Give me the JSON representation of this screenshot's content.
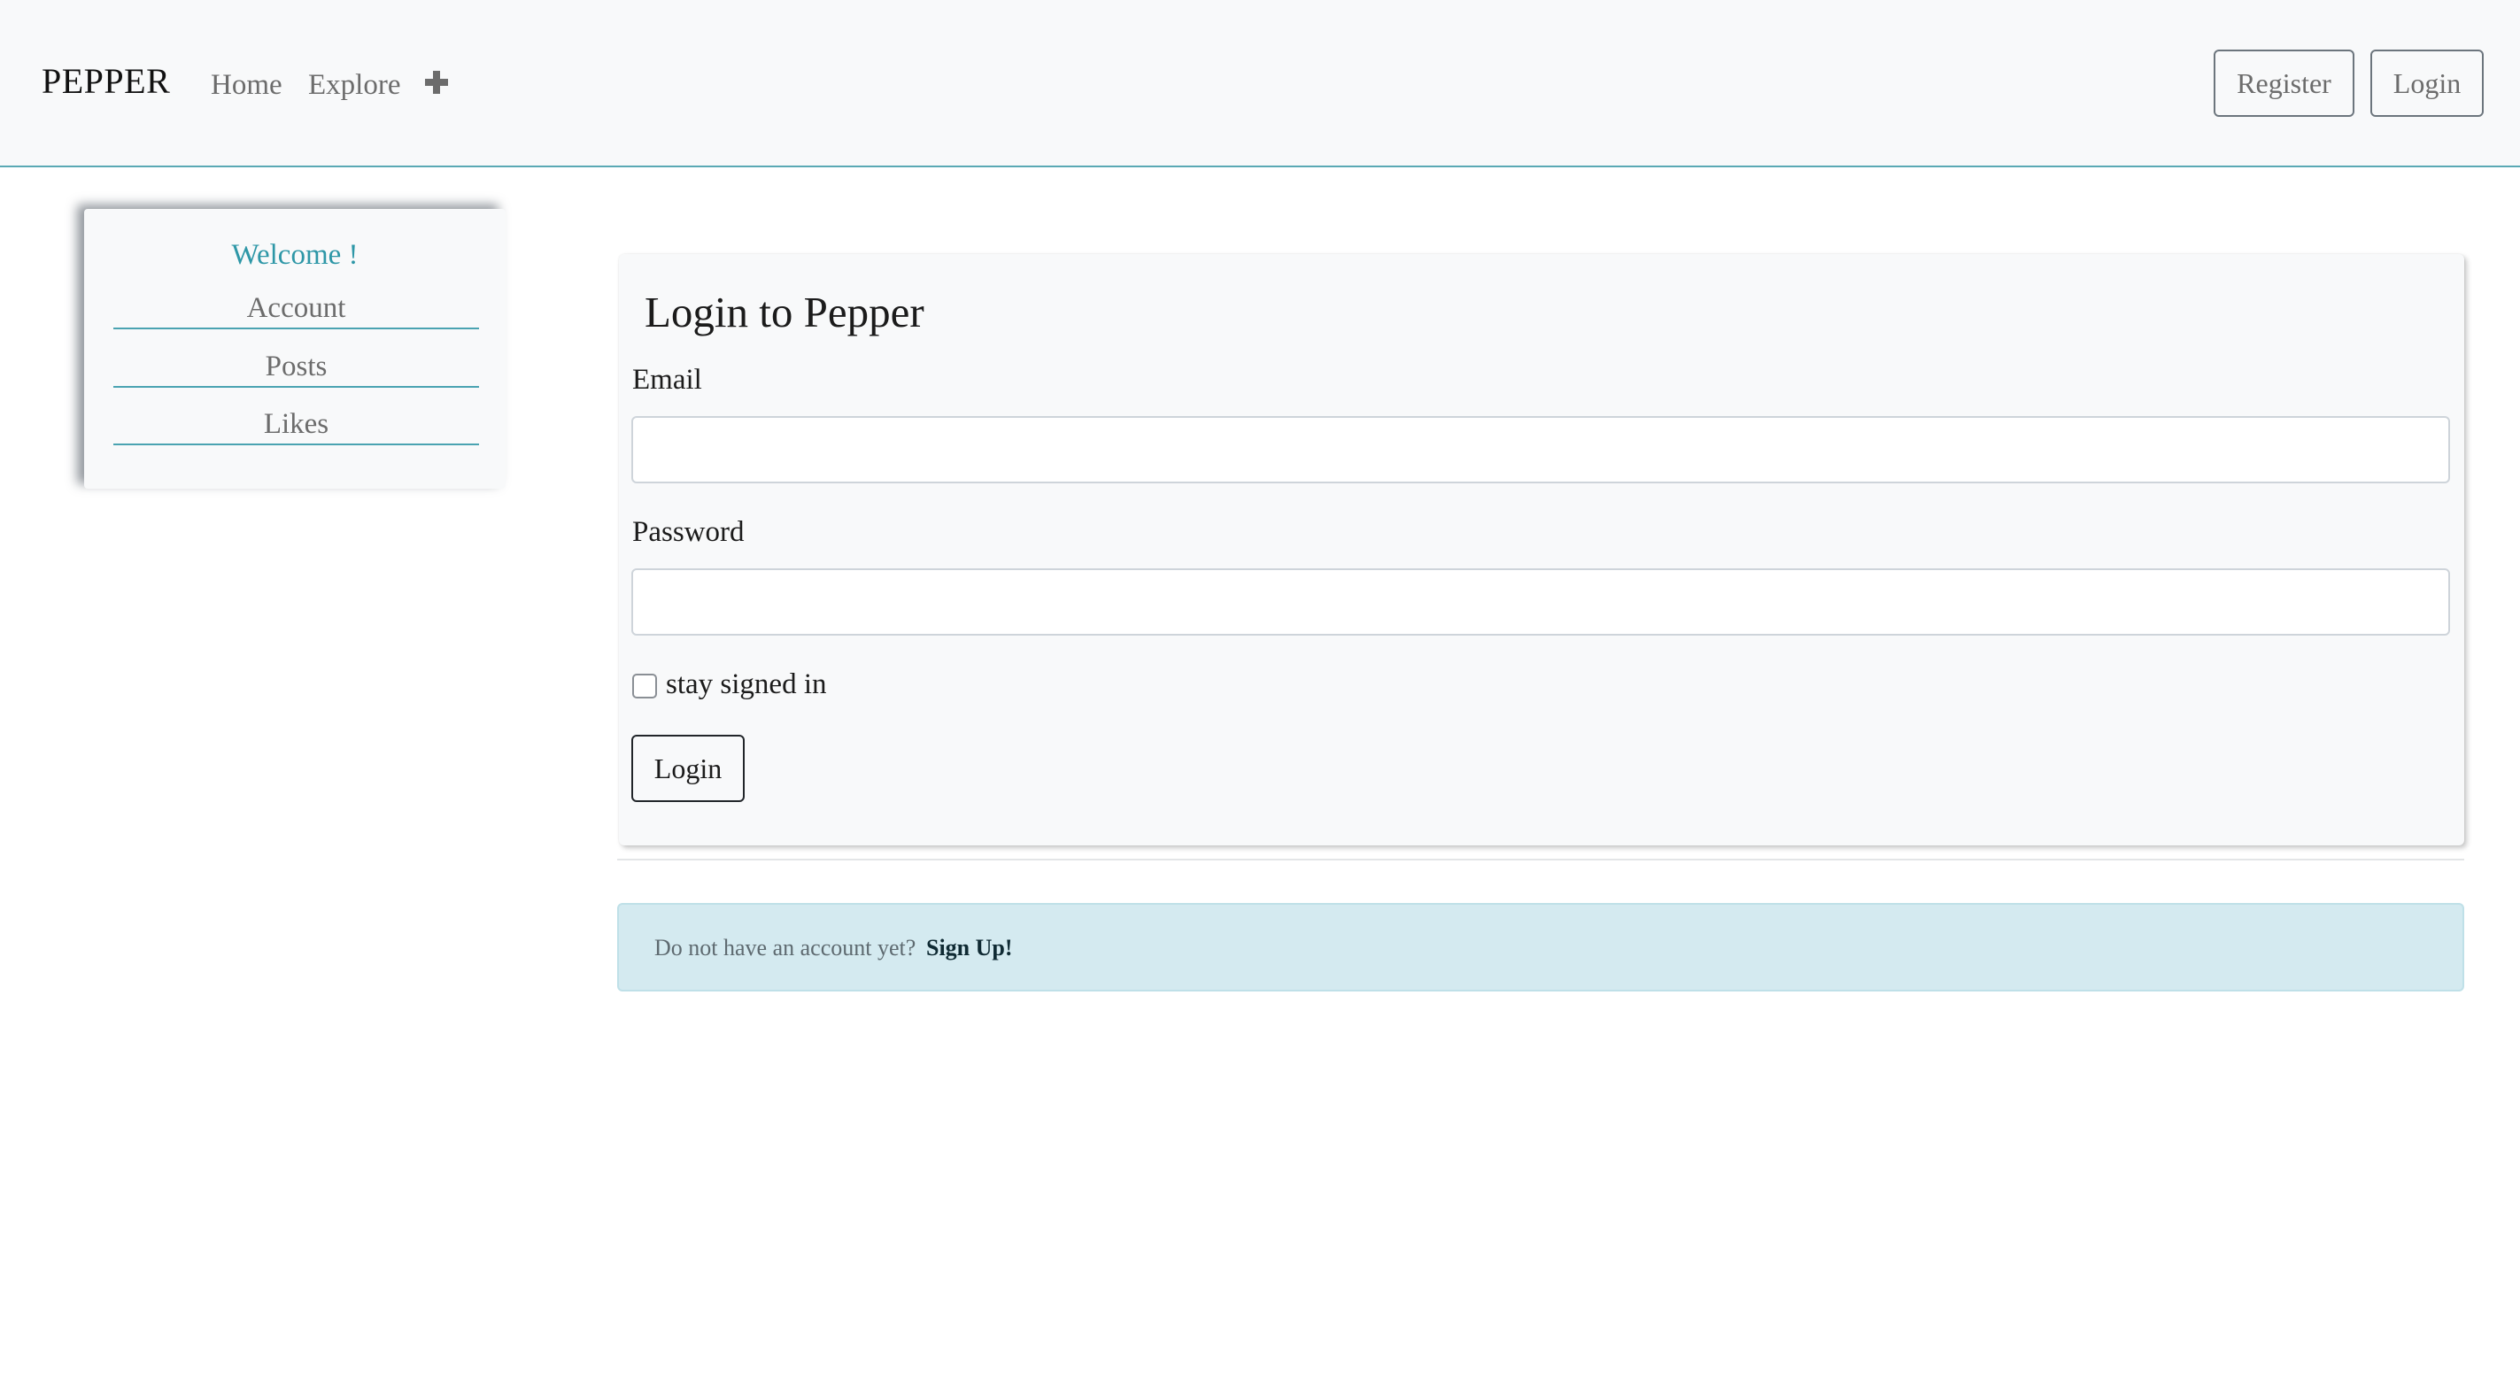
{
  "navbar": {
    "brand": "PEPPER",
    "links": [
      "Home",
      "Explore"
    ],
    "add_icon": "plus-icon",
    "register_label": "Register",
    "login_label": "Login"
  },
  "sidebar": {
    "welcome": "Welcome !",
    "items": [
      "Account",
      "Posts",
      "Likes"
    ]
  },
  "login_card": {
    "title": "Login to Pepper",
    "email_label": "Email",
    "email_value": "",
    "password_label": "Password",
    "password_value": "",
    "remember_label": "stay signed in",
    "submit_label": "Login"
  },
  "signup_alert": {
    "text": "Do not have an account yet?",
    "link": "Sign Up!"
  },
  "colors": {
    "accent": "#2e97a7",
    "navbar_bg": "#f8f9fa",
    "alert_bg": "#d4eaf0"
  }
}
